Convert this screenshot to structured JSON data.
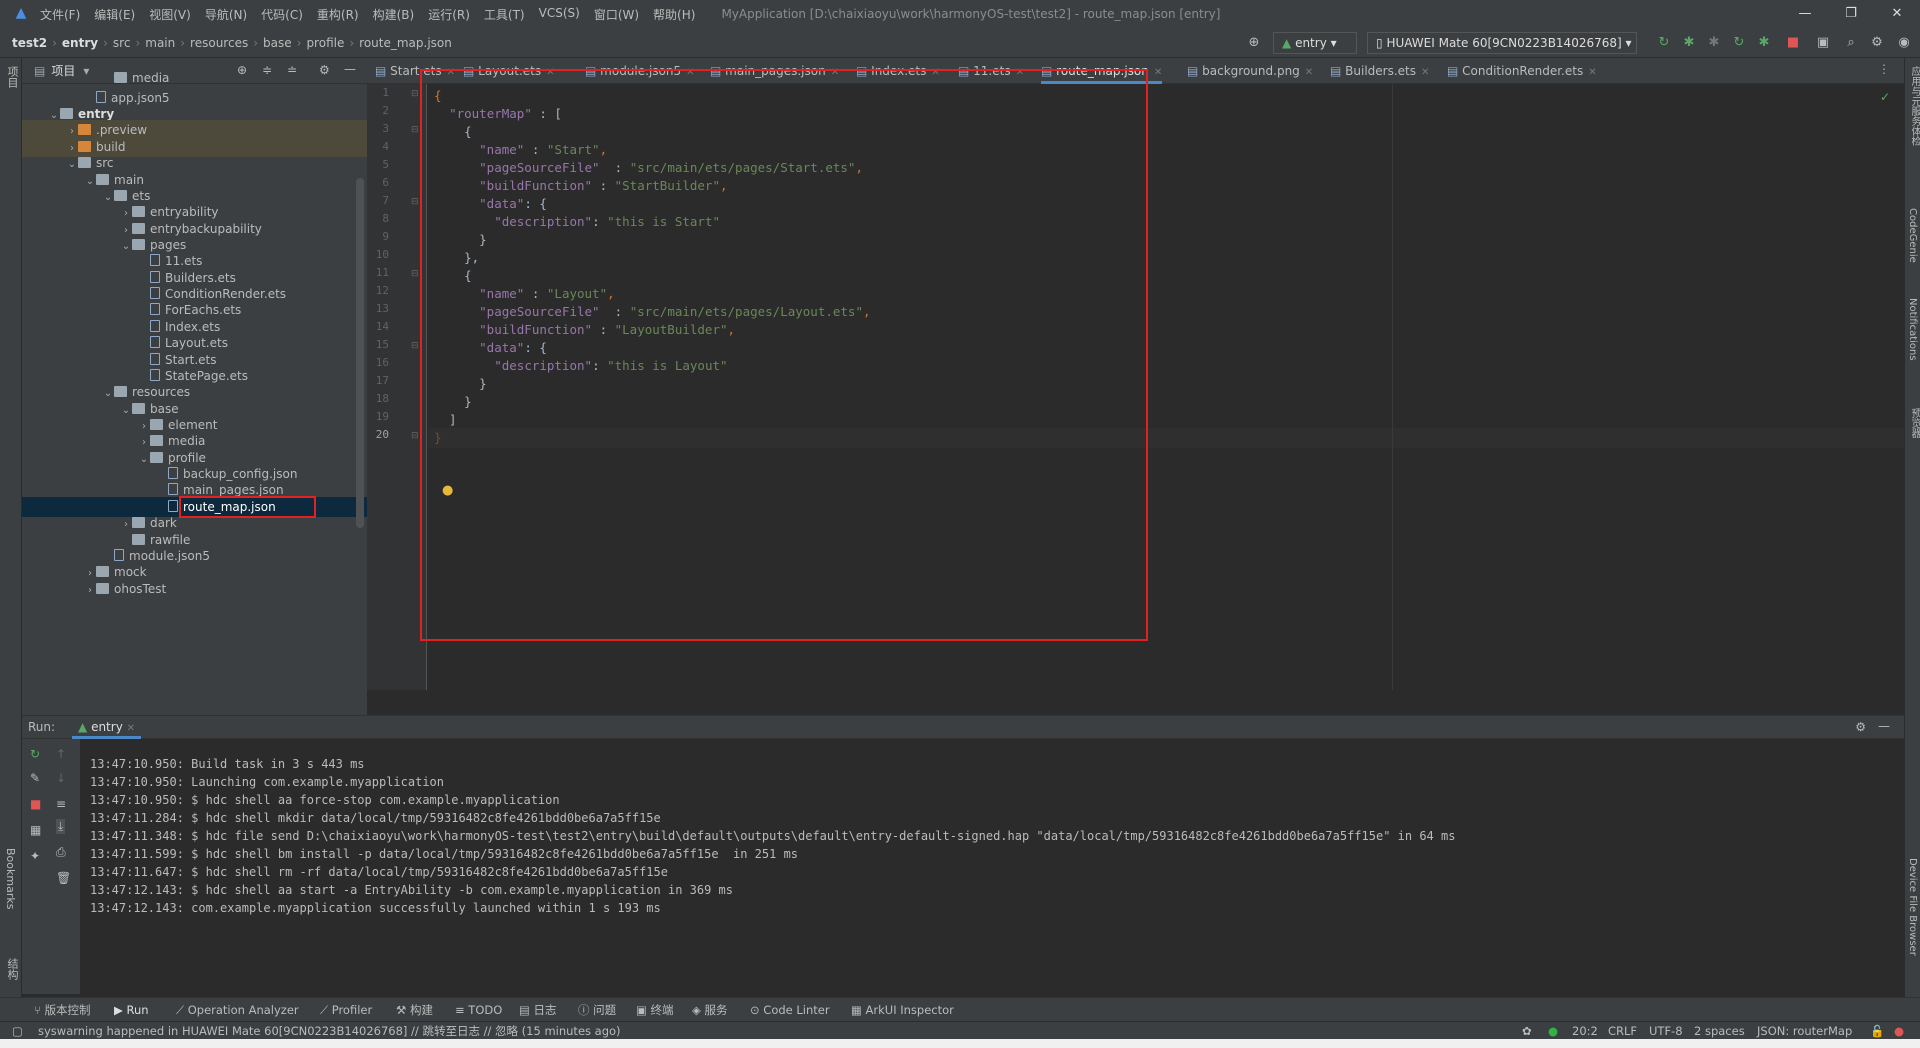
{
  "menu": {
    "items": [
      "文件(F)",
      "编辑(E)",
      "视图(V)",
      "导航(N)",
      "代码(C)",
      "重构(R)",
      "构建(B)",
      "运行(R)",
      "工具(T)",
      "VCS(S)",
      "窗口(W)",
      "帮助(H)"
    ],
    "window_title": "MyApplication [D:\\chaixiaoyu\\work\\harmonyOS-test\\test2] - route_map.json [entry]"
  },
  "breadcrumb": [
    "test2",
    "entry",
    "src",
    "main",
    "resources",
    "base",
    "profile",
    "route_map.json"
  ],
  "run_config": "entry",
  "device": "HUAWEI Mate 60[9CN0223B14026768]",
  "project_panel": {
    "title": "项目",
    "rows": [
      {
        "label": "media",
        "indent": 4,
        "kind": "folder",
        "arrow": ""
      },
      {
        "label": "app.json5",
        "indent": 3,
        "kind": "file",
        "arrow": ""
      },
      {
        "label": "entry",
        "indent": 1,
        "kind": "folder",
        "arrow": "v",
        "bold": true
      },
      {
        "label": ".preview",
        "indent": 2,
        "kind": "ofolder",
        "arrow": ">",
        "hl": true
      },
      {
        "label": "build",
        "indent": 2,
        "kind": "ofolder",
        "arrow": ">",
        "hl": true
      },
      {
        "label": "src",
        "indent": 2,
        "kind": "folder",
        "arrow": "v"
      },
      {
        "label": "main",
        "indent": 3,
        "kind": "folder",
        "arrow": "v"
      },
      {
        "label": "ets",
        "indent": 4,
        "kind": "folder",
        "arrow": "v"
      },
      {
        "label": "entryability",
        "indent": 5,
        "kind": "folder",
        "arrow": ">"
      },
      {
        "label": "entrybackupability",
        "indent": 5,
        "kind": "folder",
        "arrow": ">"
      },
      {
        "label": "pages",
        "indent": 5,
        "kind": "folder",
        "arrow": "v"
      },
      {
        "label": "11.ets",
        "indent": 6,
        "kind": "file",
        "arrow": ""
      },
      {
        "label": "Builders.ets",
        "indent": 6,
        "kind": "file",
        "arrow": ""
      },
      {
        "label": "ConditionRender.ets",
        "indent": 6,
        "kind": "file",
        "arrow": ""
      },
      {
        "label": "ForEachs.ets",
        "indent": 6,
        "kind": "file",
        "arrow": ""
      },
      {
        "label": "Index.ets",
        "indent": 6,
        "kind": "file",
        "arrow": ""
      },
      {
        "label": "Layout.ets",
        "indent": 6,
        "kind": "file",
        "arrow": ""
      },
      {
        "label": "Start.ets",
        "indent": 6,
        "kind": "file",
        "arrow": ""
      },
      {
        "label": "StatePage.ets",
        "indent": 6,
        "kind": "file",
        "arrow": ""
      },
      {
        "label": "resources",
        "indent": 4,
        "kind": "folder",
        "arrow": "v"
      },
      {
        "label": "base",
        "indent": 5,
        "kind": "folder",
        "arrow": "v"
      },
      {
        "label": "element",
        "indent": 6,
        "kind": "folder",
        "arrow": ">"
      },
      {
        "label": "media",
        "indent": 6,
        "kind": "folder",
        "arrow": ">"
      },
      {
        "label": "profile",
        "indent": 6,
        "kind": "folder",
        "arrow": "v"
      },
      {
        "label": "backup_config.json",
        "indent": 7,
        "kind": "file",
        "arrow": ""
      },
      {
        "label": "main_pages.json",
        "indent": 7,
        "kind": "file",
        "arrow": ""
      },
      {
        "label": "route_map.json",
        "indent": 7,
        "kind": "file",
        "arrow": "",
        "sel": true
      },
      {
        "label": "dark",
        "indent": 5,
        "kind": "folder",
        "arrow": ">"
      },
      {
        "label": "rawfile",
        "indent": 5,
        "kind": "folder",
        "arrow": ""
      },
      {
        "label": "module.json5",
        "indent": 4,
        "kind": "file",
        "arrow": ""
      },
      {
        "label": "mock",
        "indent": 3,
        "kind": "folder",
        "arrow": ">"
      },
      {
        "label": "ohosTest",
        "indent": 3,
        "kind": "folder",
        "arrow": ">"
      }
    ]
  },
  "tabs": [
    {
      "label": "Start.ets"
    },
    {
      "label": "Layout.ets"
    },
    {
      "label": "module.json5"
    },
    {
      "label": "main_pages.json"
    },
    {
      "label": "Index.ets"
    },
    {
      "label": "11.ets"
    },
    {
      "label": "route_map.json",
      "active": true
    },
    {
      "label": "background.png"
    },
    {
      "label": "Builders.ets"
    },
    {
      "label": "ConditionRender.ets"
    }
  ],
  "code_lines": [
    [
      [
        "p",
        "{"
      ]
    ],
    [
      [
        "t",
        "  "
      ],
      [
        "k",
        "\"routerMap\""
      ],
      [
        "t",
        " : ["
      ]
    ],
    [
      [
        "t",
        "    {"
      ]
    ],
    [
      [
        "t",
        "      "
      ],
      [
        "k",
        "\"name\""
      ],
      [
        "t",
        " : "
      ],
      [
        "s",
        "\"Start\""
      ],
      [
        "p",
        ","
      ]
    ],
    [
      [
        "t",
        "      "
      ],
      [
        "k",
        "\"pageSourceFile\""
      ],
      [
        "t",
        "  : "
      ],
      [
        "s",
        "\"src/main/ets/pages/Start.ets\""
      ],
      [
        "p",
        ","
      ]
    ],
    [
      [
        "t",
        "      "
      ],
      [
        "k",
        "\"buildFunction\""
      ],
      [
        "t",
        " : "
      ],
      [
        "s",
        "\"StartBuilder\""
      ],
      [
        "p",
        ","
      ]
    ],
    [
      [
        "t",
        "      "
      ],
      [
        "k",
        "\"data\""
      ],
      [
        "t",
        ": {"
      ]
    ],
    [
      [
        "t",
        "        "
      ],
      [
        "k",
        "\"description\""
      ],
      [
        "t",
        ": "
      ],
      [
        "s",
        "\"this is Start\""
      ]
    ],
    [
      [
        "t",
        "      }"
      ]
    ],
    [
      [
        "t",
        "    },"
      ]
    ],
    [
      [
        "t",
        "    {"
      ]
    ],
    [
      [
        "t",
        "      "
      ],
      [
        "k",
        "\"name\""
      ],
      [
        "t",
        " : "
      ],
      [
        "s",
        "\"Layout\""
      ],
      [
        "p",
        ","
      ]
    ],
    [
      [
        "t",
        "      "
      ],
      [
        "k",
        "\"pageSourceFile\""
      ],
      [
        "t",
        "  : "
      ],
      [
        "s",
        "\"src/main/ets/pages/Layout.ets\""
      ],
      [
        "p",
        ","
      ]
    ],
    [
      [
        "t",
        "      "
      ],
      [
        "k",
        "\"buildFunction\""
      ],
      [
        "t",
        " : "
      ],
      [
        "s",
        "\"LayoutBuilder\""
      ],
      [
        "p",
        ","
      ]
    ],
    [
      [
        "t",
        "      "
      ],
      [
        "k",
        "\"data\""
      ],
      [
        "t",
        ": {"
      ]
    ],
    [
      [
        "t",
        "        "
      ],
      [
        "k",
        "\"description\""
      ],
      [
        "t",
        ": "
      ],
      [
        "s",
        "\"this is Layout\""
      ]
    ],
    [
      [
        "t",
        "      }"
      ]
    ],
    [
      [
        "t",
        "    }"
      ]
    ],
    [
      [
        "t",
        "  ]"
      ]
    ],
    [
      [
        "p",
        "}"
      ]
    ]
  ],
  "run_panel": {
    "title": "Run:",
    "config": "entry",
    "log": [
      "13:47:10.950: Build task in 3 s 443 ms",
      "13:47:10.950: Launching com.example.myapplication",
      "13:47:10.950: $ hdc shell aa force-stop com.example.myapplication",
      "13:47:11.284: $ hdc shell mkdir data/local/tmp/59316482c8fe4261bdd0be6a7a5ff15e",
      "13:47:11.348: $ hdc file send D:\\chaixiaoyu\\work\\harmonyOS-test\\test2\\entry\\build\\default\\outputs\\default\\entry-default-signed.hap \"data/local/tmp/59316482c8fe4261bdd0be6a7a5ff15e\" in 64 ms",
      "13:47:11.599: $ hdc shell bm install -p data/local/tmp/59316482c8fe4261bdd0be6a7a5ff15e  in 251 ms",
      "13:47:11.647: $ hdc shell rm -rf data/local/tmp/59316482c8fe4261bdd0be6a7a5ff15e",
      "13:47:12.143: $ hdc shell aa start -a EntryAbility -b com.example.myapplication in 369 ms",
      "13:47:12.143: com.example.myapplication successfully launched within 1 s 193 ms"
    ]
  },
  "bottom_tools": [
    "版本控制",
    "Run",
    "Operation Analyzer",
    "Profiler",
    "构建",
    "TODO",
    "日志",
    "问题",
    "终端",
    "服务",
    "Code Linter",
    "ArkUI Inspector"
  ],
  "status": {
    "message": "syswarning happened in HUAWEI Mate 60[9CN0223B14026768] // 跳转至日志 // 忽略 (15 minutes ago)",
    "position": "20:2",
    "line_sep": "CRLF",
    "encoding": "UTF-8",
    "indent": "2 spaces",
    "schema": "JSON: routerMap"
  },
  "side_labels": {
    "left": [
      "项目",
      "Bookmarks",
      "结构"
    ],
    "right": [
      "应用与元服务体检",
      "CodeGenie",
      "Notifications",
      "预览器",
      "Device File Browser"
    ]
  },
  "colors": {
    "accent": "#4a88c7",
    "highlight_box": "#e22222",
    "selection": "#0d293e"
  }
}
